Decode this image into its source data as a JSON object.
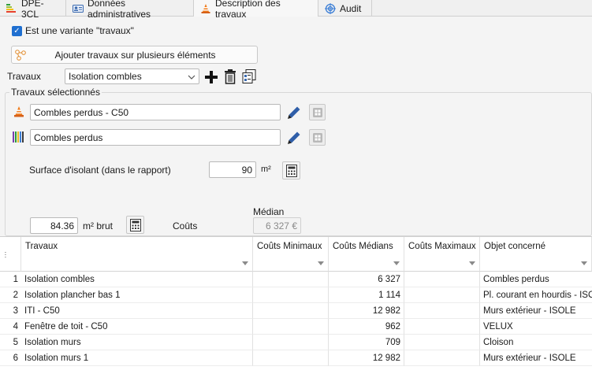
{
  "tabs": [
    {
      "label": "DPE-3CL",
      "icon": "energy-rating-icon"
    },
    {
      "label": "Données administratives",
      "icon": "admin-card-icon"
    },
    {
      "label": "Description des travaux",
      "icon": "traffic-cone-icon"
    },
    {
      "label": "Audit",
      "icon": "target-icon"
    }
  ],
  "variant_checkbox": {
    "label": "Est une variante \"travaux\"",
    "checked": true
  },
  "add_multiple_button": "Ajouter travaux sur plusieurs éléments",
  "travaux": {
    "label": "Travaux",
    "selected": "Isolation combles"
  },
  "group_title": "Travaux sélectionnés",
  "selected_item_1": "Combles perdus - C50",
  "selected_item_2": "Combles perdus",
  "surface": {
    "label": "Surface d'isolant (dans le rapport)",
    "value": "90",
    "unit": "m²"
  },
  "brut": {
    "value": "84.36",
    "unit": "m² brut"
  },
  "couts": {
    "label": "Coûts",
    "median_label": "Médian",
    "median_value": "6 327 €"
  },
  "table": {
    "columns": [
      "Travaux",
      "Coûts Minimaux",
      "Coûts Médians",
      "Coûts Maximaux",
      "Objet concerné"
    ],
    "rows": [
      {
        "n": "1",
        "travaux": "Isolation combles",
        "min": "",
        "med": "6 327",
        "max": "",
        "objet": "Combles perdus"
      },
      {
        "n": "2",
        "travaux": "Isolation plancher bas 1",
        "min": "",
        "med": "1 114",
        "max": "",
        "objet": "Pl. courant en hourdis - ISOLE"
      },
      {
        "n": "3",
        "travaux": "ITI - C50",
        "min": "",
        "med": "12 982",
        "max": "",
        "objet": "Murs extérieur - ISOLE"
      },
      {
        "n": "4",
        "travaux": "Fenêtre de toit - C50",
        "min": "",
        "med": "962",
        "max": "",
        "objet": "VELUX"
      },
      {
        "n": "5",
        "travaux": "Isolation murs",
        "min": "",
        "med": "709",
        "max": "",
        "objet": "Cloison"
      },
      {
        "n": "6",
        "travaux": "Isolation murs 1",
        "min": "",
        "med": "12 982",
        "max": "",
        "objet": "Murs extérieur - ISOLE"
      }
    ]
  }
}
